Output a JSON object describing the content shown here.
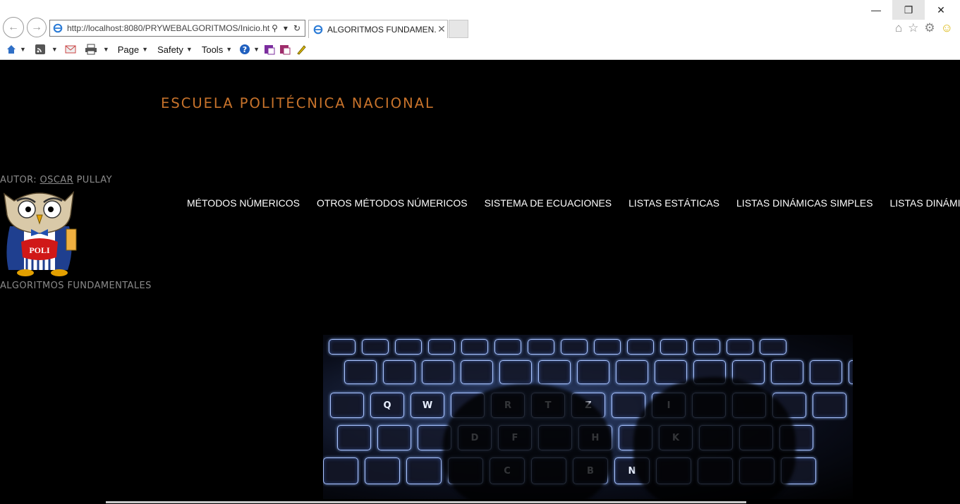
{
  "browser": {
    "url": "http://localhost:8080/PRYWEBALGORITMOS/Inicio.ht",
    "tab_title": "ALGORITMOS FUNDAMEN...",
    "toolbar": {
      "page_label": "Page",
      "safety_label": "Safety",
      "tools_label": "Tools"
    }
  },
  "site": {
    "school_name": "ESCUELA POLITÉCNICA NACIONAL",
    "author_prefix": "AUTOR: ",
    "author_name_underlined": "OSCAR",
    "author_name_rest": " PULLAY",
    "logo_text": "POLI",
    "subtitle": "ALGORITMOS FUNDAMENTALES",
    "menu": [
      "MÉTODOS NÚMERICOS",
      "OTROS MÉTODOS NÚMERICOS",
      "SISTEMA DE ECUACIONES",
      "LISTAS ESTÁTICAS",
      "LISTAS DINÁMICAS SIMPLES",
      "LISTAS DINÁMICAS D"
    ],
    "colors": {
      "background": "#000000",
      "school_name": "#c8732b",
      "muted_text": "#8a8a8a",
      "menu_text": "#ffffff"
    }
  },
  "hero_keys": {
    "row1": [
      "Q",
      "W",
      "R",
      "T",
      "Z",
      "I"
    ],
    "row2": [
      "D",
      "F",
      "H",
      "K"
    ],
    "row3": [
      "C",
      "B",
      "N"
    ]
  }
}
